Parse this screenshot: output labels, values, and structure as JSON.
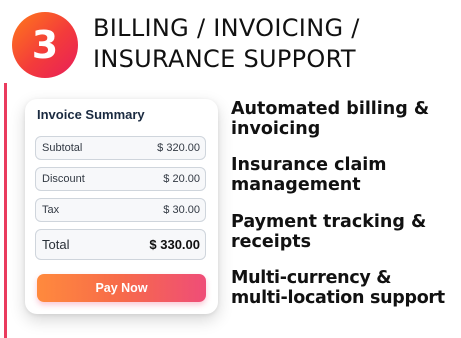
{
  "badge": {
    "number": "3"
  },
  "heading": {
    "line1": "BILLING / INVOICING /",
    "line2": "INSURANCE SUPPORT"
  },
  "invoice": {
    "title": "Invoice Summary",
    "rows": [
      {
        "label": "Subtotal",
        "amount": "$ 320.00"
      },
      {
        "label": "Discount",
        "amount": "$ 20.00"
      },
      {
        "label": "Tax",
        "amount": "$ 30.00"
      }
    ],
    "total": {
      "label": "Total",
      "amount": "$ 330.00"
    },
    "pay_label": "Pay Now"
  },
  "features": [
    {
      "line1": "Automated billing &",
      "line2": "invoicing"
    },
    {
      "line1": "Insurance claim",
      "line2": "management"
    },
    {
      "line1": "Payment tracking &",
      "line2": "receipts"
    },
    {
      "line1": "Multi-currency &",
      "line2": "multi-location support"
    }
  ],
  "colors": {
    "accent": "#ea3b5e",
    "badge_gradient": [
      "#ff7a1a",
      "#e81e5a"
    ],
    "button_gradient": [
      "#ff8a3d",
      "#ef4d78"
    ]
  }
}
